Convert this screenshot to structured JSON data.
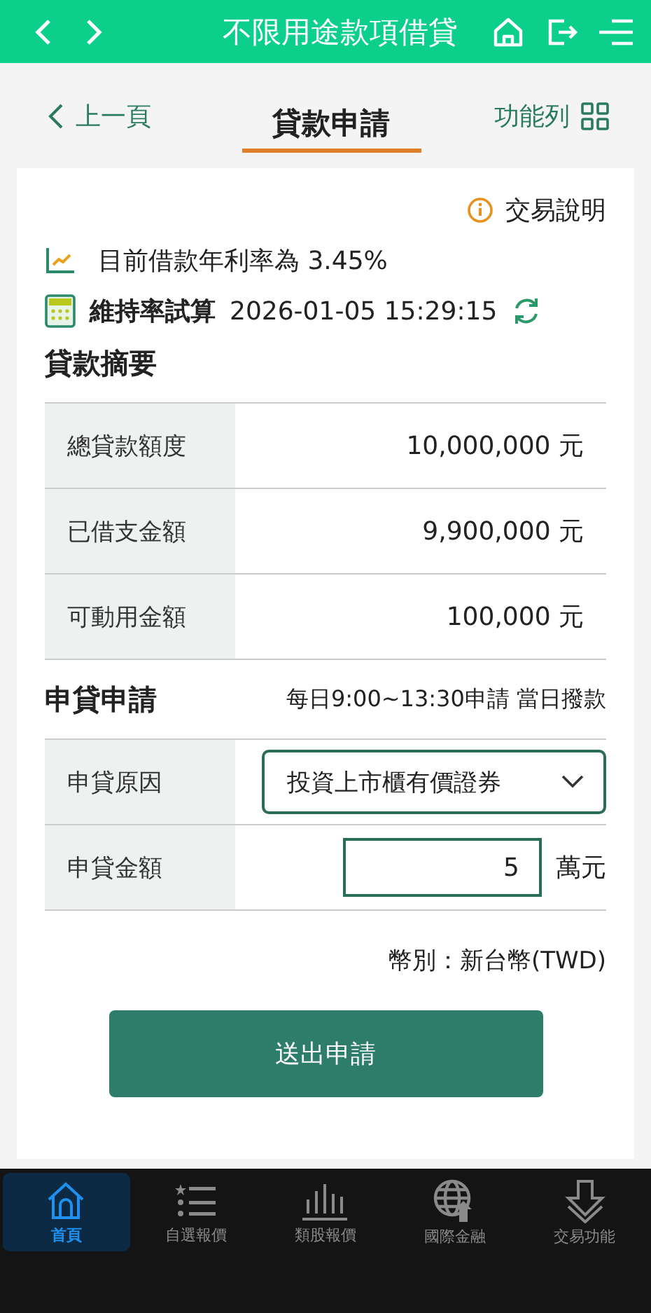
{
  "header": {
    "title": "不限用途款項借貸"
  },
  "subheader": {
    "back": "上一頁",
    "title": "貸款申請",
    "menu": "功能列"
  },
  "info_link": "交易說明",
  "rate_text": "目前借款年利率為 3.45%",
  "maintenance": {
    "label": "維持率試算",
    "time": "2026-01-05 15:29:15"
  },
  "summary": {
    "title": "貸款摘要",
    "rows": [
      {
        "label": "總貸款額度",
        "value": "10,000,000 元"
      },
      {
        "label": "已借支金額",
        "value": "9,900,000 元"
      },
      {
        "label": "可動用金額",
        "value": "100,000 元"
      }
    ]
  },
  "application": {
    "title": "申貸申請",
    "note": "每日9:00~13:30申請 當日撥款",
    "reason": {
      "label": "申貸原因",
      "value": "投資上市櫃有價證券"
    },
    "amount": {
      "label": "申貸金額",
      "value": "5",
      "unit": "萬元"
    }
  },
  "currency": "幣別：新台幣(TWD)",
  "submit": "送出申請",
  "tabbar": [
    {
      "label": "首頁",
      "selected": true
    },
    {
      "label": "自選報價",
      "selected": false
    },
    {
      "label": "類股報價",
      "selected": false
    },
    {
      "label": "國際金融",
      "selected": false
    },
    {
      "label": "交易功能",
      "selected": false
    }
  ]
}
